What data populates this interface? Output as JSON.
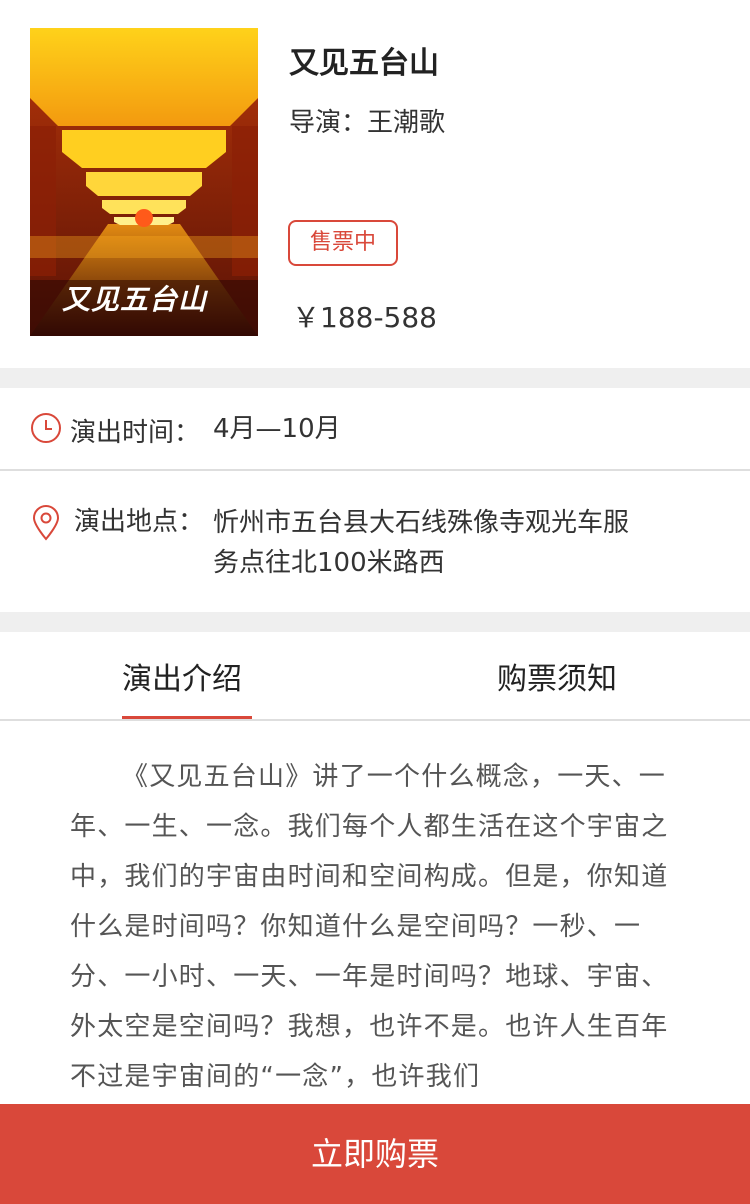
{
  "show": {
    "title": "又见五台山",
    "director_label": "导演：",
    "director_name": "王潮歌",
    "status": "售票中",
    "price": "￥188-588",
    "poster_caption": "又见五台山"
  },
  "info": {
    "time_label": "演出时间：",
    "time_value": "4月—10月",
    "place_label": "演出地点：",
    "place_value_line1": "忻州市五台县大石线殊像寺观光车服",
    "place_value_line2": "务点往北100米路西"
  },
  "tabs": [
    {
      "label": "演出介绍",
      "active": true
    },
    {
      "label": "购票须知",
      "active": false
    }
  ],
  "intro_text": "《又见五台山》讲了一个什么概念，一天、一年、一生、一念。我们每个人都生活在这个宇宙之中，我们的宇宙由时间和空间构成。但是，你知道什么是时间吗？你知道什么是空间吗？一秒、一分、一小时、一天、一年是时间吗？地球、宇宙、外太空是空间吗？我想，也许不是。也许人生百年不过是宇宙间的“一念”，也许我们",
  "buy_button": "立即购票",
  "colors": {
    "accent": "#d9483a",
    "gap": "#efefef"
  },
  "icons": {
    "time": "clock-icon",
    "place": "location-pin-icon"
  }
}
